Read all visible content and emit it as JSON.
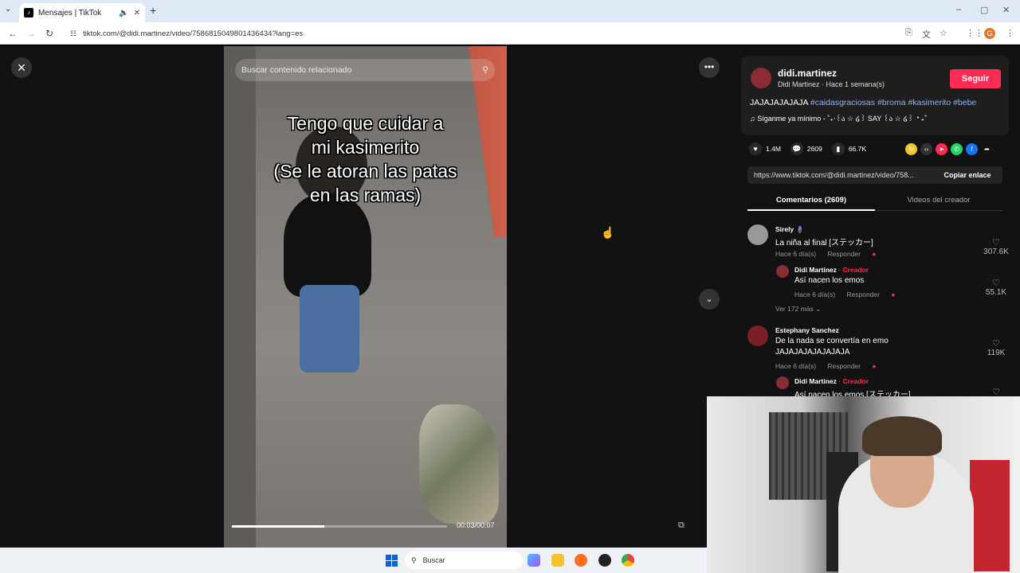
{
  "browser": {
    "tab_title": "Mensajes | TikTok",
    "url": "tiktok.com/@didi.martinez/video/7586815049801436434?lang=es",
    "profile_initial": "G"
  },
  "video": {
    "search_placeholder": "Buscar contenido relacionado",
    "caption_lines": [
      "Tengo que cuidar a",
      "mi kasimerito",
      "(Se le atoran las patas",
      "en las ramas)"
    ],
    "time": "00:03/00:07",
    "progress": 0.43
  },
  "author": {
    "username": "didi.martinez",
    "subtitle": "Didi Martinez · Hace 1 semana(s)",
    "follow_label": "Seguir",
    "description_text": "JAJAJAJAJAJA",
    "hashtags": [
      "#caidasgraciosas",
      "#broma",
      "#kasimerito",
      "#bebe"
    ],
    "music": "♫  Síganme ya mínimo - ˚₊‧꒰ა ☆ ໒꒱ SAY ꒰ა ☆ ໒꒱ ‧₊˚"
  },
  "stats": {
    "likes": "1.4M",
    "comments": "2609",
    "saves": "66.7K"
  },
  "link": {
    "url": "https://www.tiktok.com/@didi.martinez/video/758...",
    "copy_label": "Copiar enlace"
  },
  "tabs": {
    "comments": "Comentarios (2609)",
    "creator_videos": "Videos del creador"
  },
  "comments": [
    {
      "name": "Sirely 🪻",
      "text": "La niña al final [ステッカー]",
      "time": "Hace 6 día(s)",
      "reply": "Responder",
      "likes": "307.6K"
    },
    {
      "name": "Didi Martinez",
      "creator_label": " · Creador",
      "text": "Así nacen los emos",
      "time": "Hace 6 día(s)",
      "reply": "Responder",
      "likes": "55.1K"
    },
    {
      "more": "Ver 172 más ⌄"
    },
    {
      "name": "Estephany Sanchez",
      "text": "De la nada se convertía en emo",
      "text2": "JAJAJAJAJAJAJAJA",
      "time": "Hace 6 día(s)",
      "reply": "Responder",
      "likes": "119K"
    },
    {
      "name": "Didi Martinez",
      "creator_label": " · Creador",
      "text": "Así nacen los emos [ステッカー]"
    }
  ],
  "taskbar": {
    "search_label": "Buscar"
  },
  "colors": {
    "accent": "#fe2c55",
    "hashtag": "#8ab4f8"
  }
}
